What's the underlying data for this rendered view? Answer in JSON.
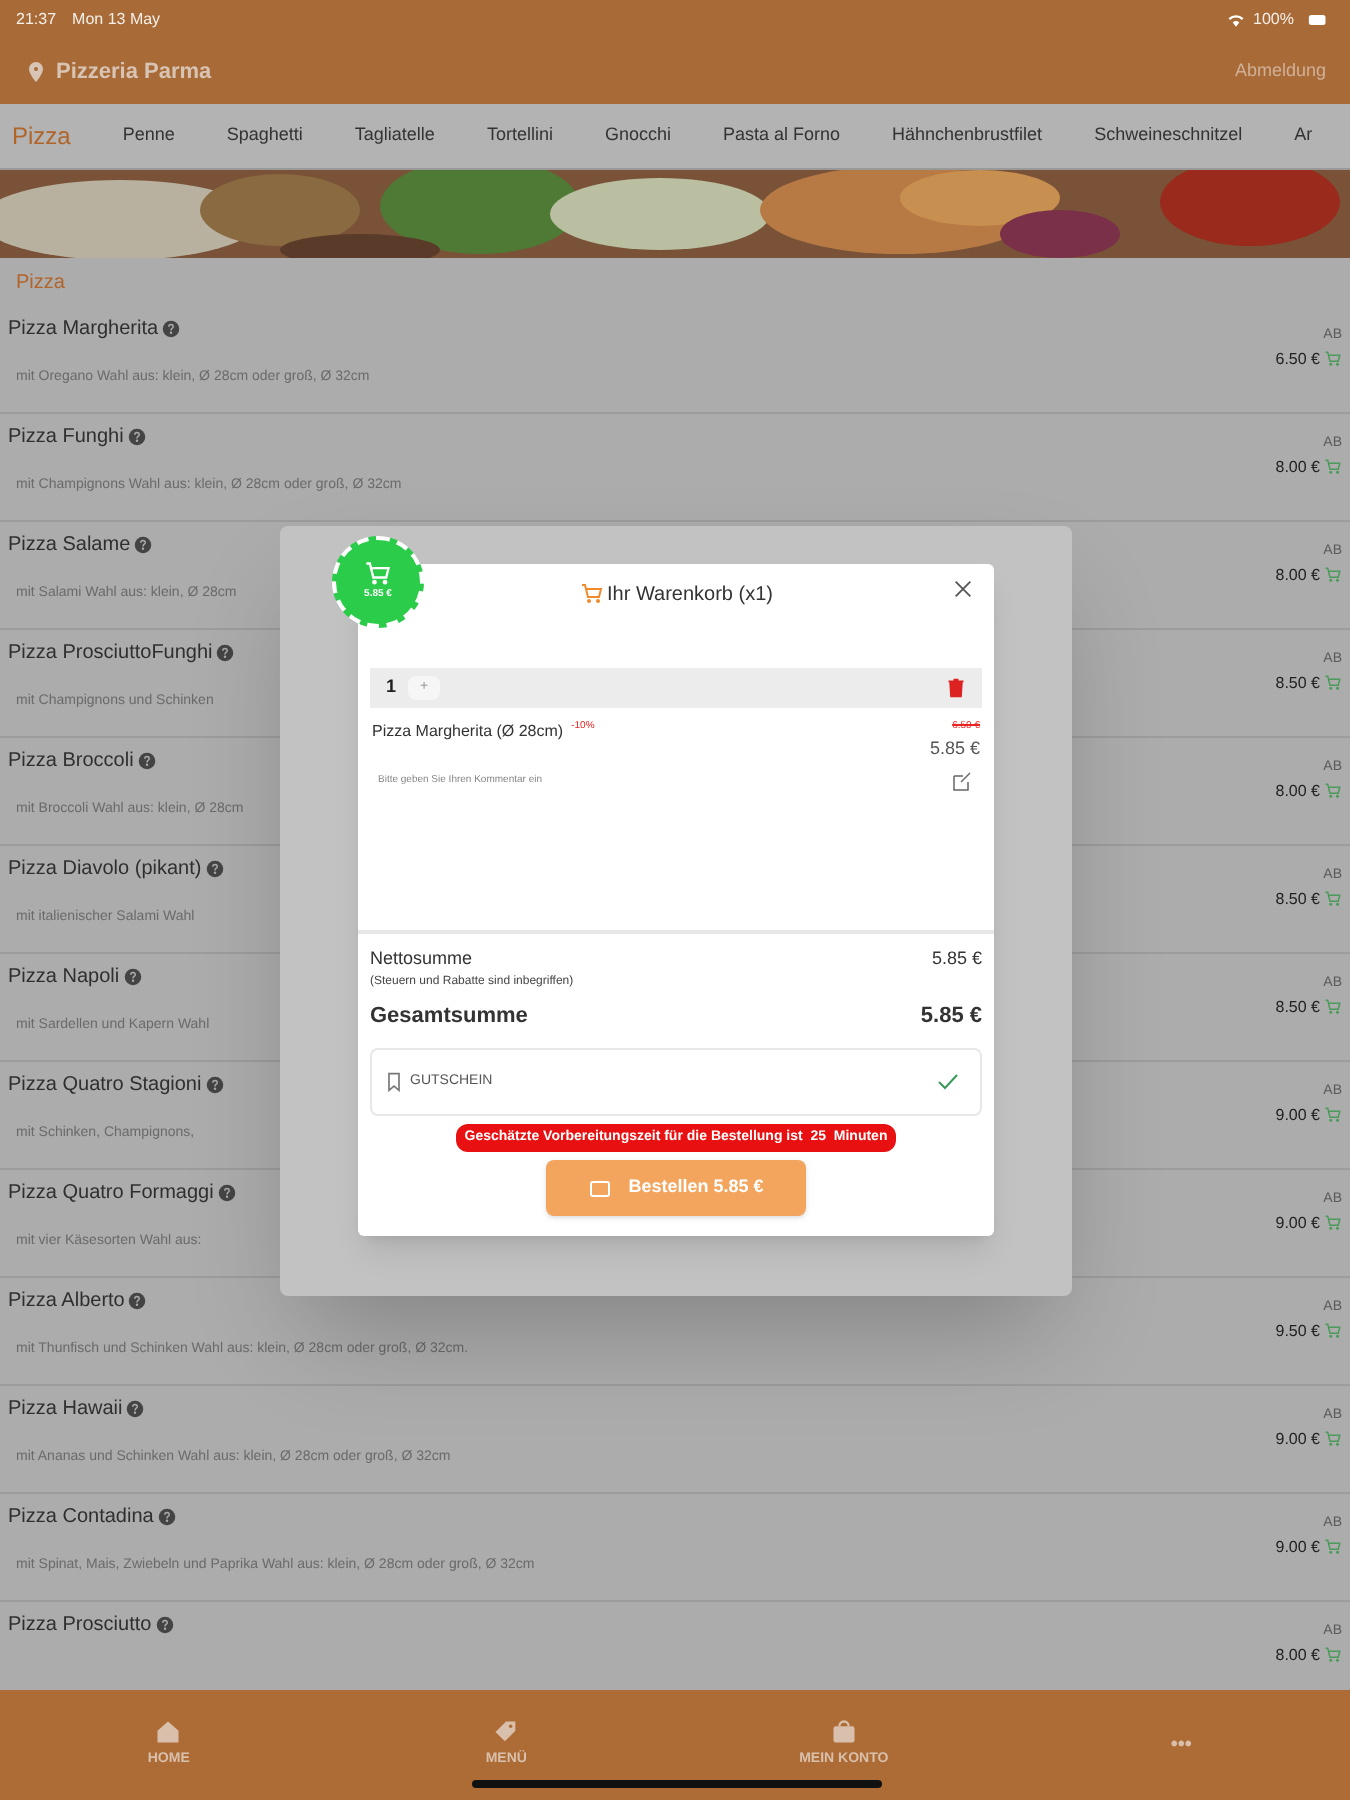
{
  "status_bar": {
    "time": "21:37",
    "date": "Mon 13 May",
    "battery": "100%"
  },
  "header": {
    "restaurant": "Pizzeria Parma",
    "logout": "Abmeldung"
  },
  "tabs": [
    {
      "label": "Pizza",
      "selected": true
    },
    {
      "label": "Penne",
      "selected": false
    },
    {
      "label": "Spaghetti",
      "selected": false
    },
    {
      "label": "Tagliatelle",
      "selected": false
    },
    {
      "label": "Tortellini",
      "selected": false
    },
    {
      "label": "Gnocchi",
      "selected": false
    },
    {
      "label": "Pasta al Forno",
      "selected": false
    },
    {
      "label": "Hähnchenbrustfilet",
      "selected": false
    },
    {
      "label": "Schweineschnitzel",
      "selected": false
    },
    {
      "label": "Ar",
      "selected": false
    }
  ],
  "section_title": "Pizza",
  "products": [
    {
      "name": "Pizza Margherita",
      "description": "mit Oregano Wahl aus: klein, Ø 28cm oder groß, Ø 32cm",
      "from": "AB",
      "price": "6.50 €"
    },
    {
      "name": "Pizza Funghi",
      "description": "mit Champignons Wahl aus: klein, Ø 28cm oder groß, Ø 32cm",
      "from": "AB",
      "price": "8.00 €"
    },
    {
      "name": "Pizza Salame",
      "description": "mit Salami Wahl aus: klein, Ø 28cm",
      "from": "AB",
      "price": "8.00 €"
    },
    {
      "name": "Pizza ProsciuttoFunghi",
      "description": "mit Champignons und Schinken",
      "from": "AB",
      "price": "8.50 €"
    },
    {
      "name": "Pizza Broccoli",
      "description": "mit Broccoli Wahl aus: klein, Ø 28cm",
      "from": "AB",
      "price": "8.00 €"
    },
    {
      "name": "Pizza Diavolo (pikant)",
      "description": "mit italienischer Salami Wahl",
      "from": "AB",
      "price": "8.50 €"
    },
    {
      "name": "Pizza Napoli",
      "description": "mit Sardellen und Kapern Wahl",
      "from": "AB",
      "price": "8.50 €"
    },
    {
      "name": "Pizza Quatro Stagioni",
      "description": "mit Schinken, Champignons,",
      "from": "AB",
      "price": "9.00 €"
    },
    {
      "name": "Pizza Quatro Formaggi",
      "description": "mit vier Käsesorten Wahl aus:",
      "from": "AB",
      "price": "9.00 €"
    },
    {
      "name": "Pizza Alberto",
      "description": "mit Thunfisch und Schinken Wahl aus: klein, Ø 28cm oder groß, Ø 32cm.",
      "from": "AB",
      "price": "9.50 €"
    },
    {
      "name": "Pizza Hawaii",
      "description": "mit Ananas und Schinken Wahl aus: klein, Ø 28cm oder groß, Ø 32cm",
      "from": "AB",
      "price": "9.00 €"
    },
    {
      "name": "Pizza Contadina",
      "description": "mit Spinat, Mais, Zwiebeln und Paprika Wahl aus: klein, Ø 28cm oder groß, Ø 32cm",
      "from": "AB",
      "price": "9.00 €"
    },
    {
      "name": "Pizza Prosciutto",
      "from": "AB",
      "price": "8.00 €"
    }
  ],
  "cart": {
    "badge_total": "5.85 €",
    "title": "Ihr Warenkorb (x1)",
    "items": [
      {
        "quantity": "1",
        "plus": "+",
        "name": "Pizza Margherita (Ø 28cm)",
        "discount": "-10%",
        "old_price": "6.50 €",
        "price": "5.85 €",
        "comment_placeholder": "Bitte geben Sie Ihren Kommentar ein"
      }
    ],
    "net_label": "Nettosumme",
    "net_note": "(Steuern und Rabatte sind inbegriffen)",
    "net_value": "5.85 €",
    "total_label": "Gesamtsumme",
    "total_value": "5.85 €",
    "voucher": "GUTSCHEIN",
    "prep_notice": "Geschätzte Vorbereitungszeit für die Bestellung ist  25  Minuten",
    "order_button": "Bestellen 5.85 €"
  },
  "bottom_nav": [
    {
      "label": "HOME",
      "kind": "home"
    },
    {
      "label": "MENÜ",
      "kind": "menu"
    },
    {
      "label": "MEIN KONTO",
      "kind": "account"
    },
    {
      "label": "•••",
      "kind": "more"
    }
  ]
}
